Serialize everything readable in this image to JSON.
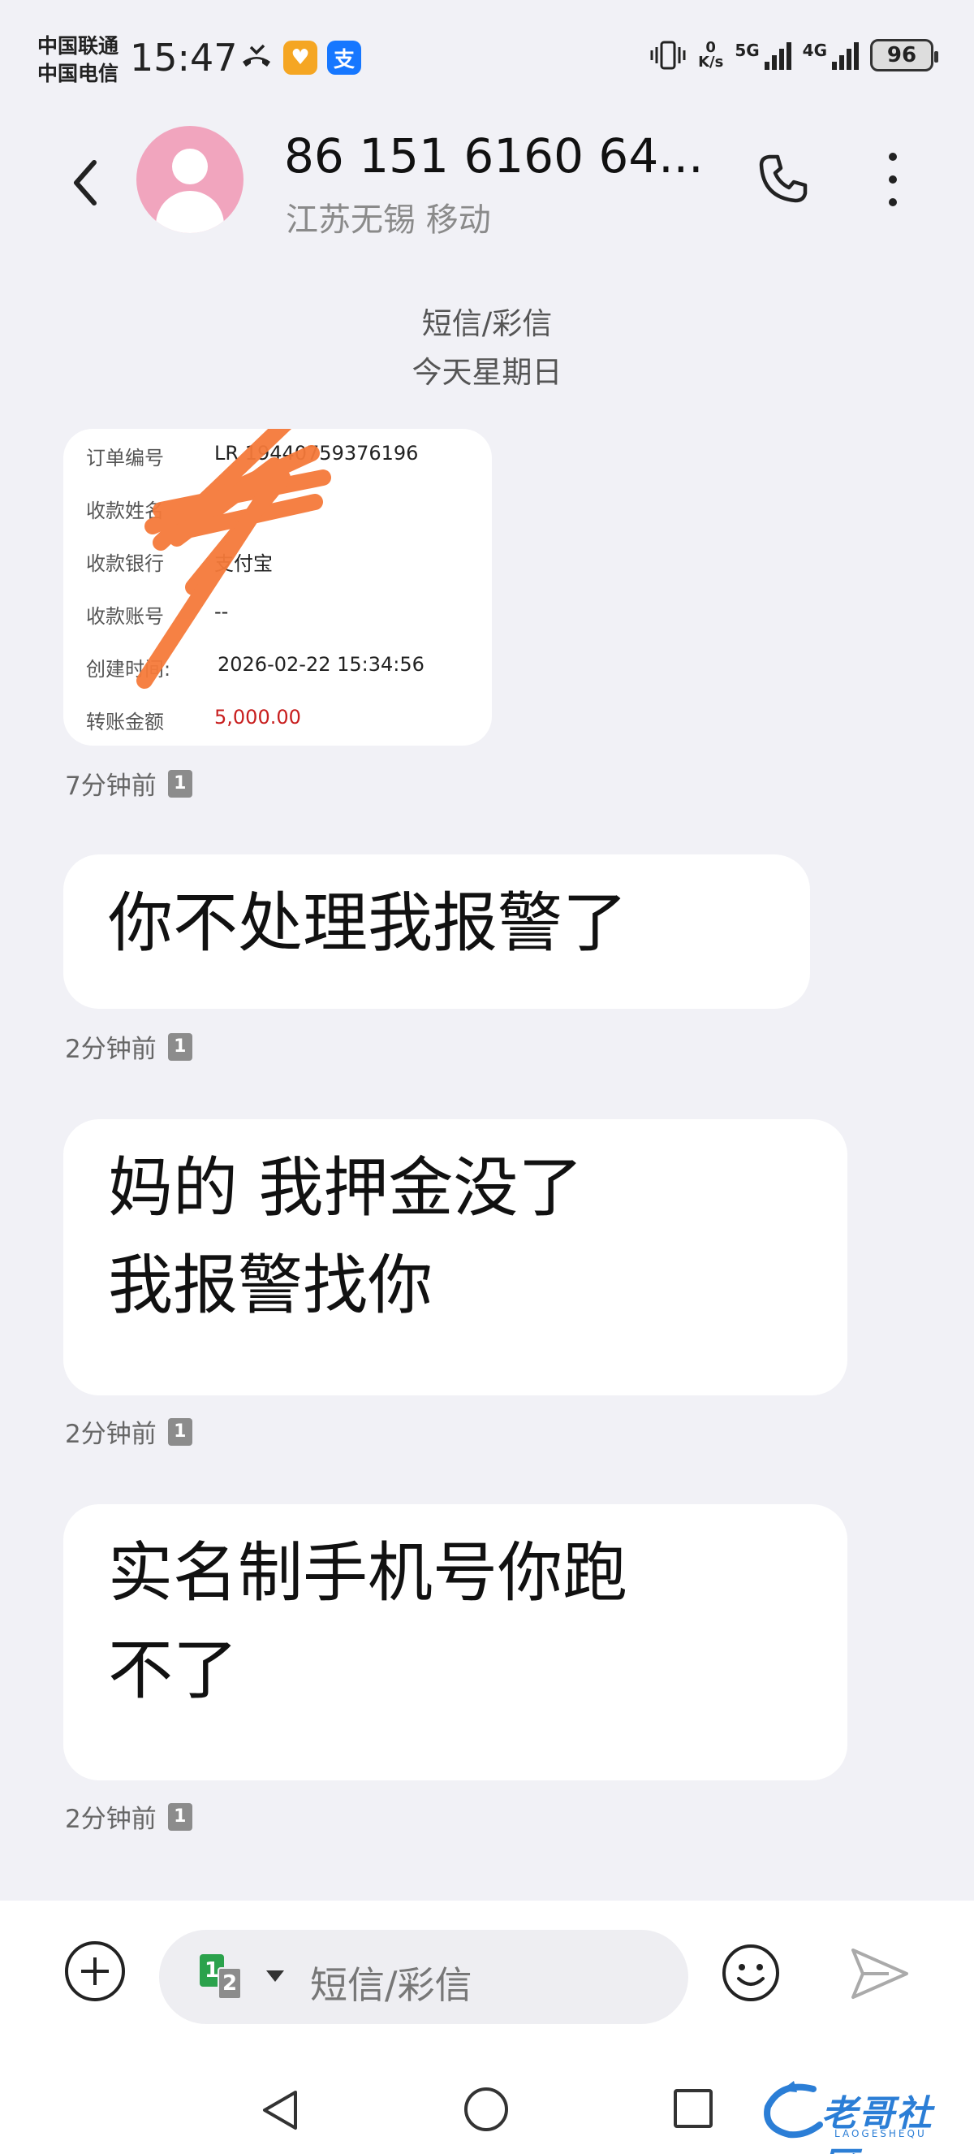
{
  "status_bar": {
    "carrier_1": "中国联通",
    "carrier_2": "中国电信",
    "time": "15:47",
    "net_speed_value": "0",
    "net_speed_unit": "K/s",
    "signal_1": "5G",
    "signal_2": "4G",
    "battery": "96"
  },
  "header": {
    "contact_name": "86 151 6160 64...",
    "contact_location": "江苏无锡 移动"
  },
  "conversation": {
    "type_label": "短信/彩信",
    "date_label": "今天星期日"
  },
  "image_message": {
    "rows": [
      {
        "label": "订单编号",
        "value": "LR     19440759376196"
      },
      {
        "label": "收款姓名",
        "value": ""
      },
      {
        "label": "收款银行",
        "value": "支付宝"
      },
      {
        "label": "收款账号",
        "value": "--"
      },
      {
        "label": "创建时间:",
        "value": "2026-02-22 15:34:56"
      },
      {
        "label": "转账金额",
        "value": "5,000.00"
      }
    ],
    "time": "7分钟前",
    "sim": "1"
  },
  "messages": [
    {
      "text": "你不处理我报警了",
      "time": "2分钟前",
      "sim": "1"
    },
    {
      "text": "妈的 我押金没了\n我报警找你",
      "line1": "妈的 我押金没了",
      "line2": "我报警找你",
      "time": "2分钟前",
      "sim": "1"
    },
    {
      "text": "实名制手机号你跑\n不了",
      "line1": "实名制手机号你跑",
      "line2": "不了",
      "time": "2分钟前",
      "sim": "1"
    }
  ],
  "composer": {
    "placeholder": "短信/彩信",
    "sim_primary": "1",
    "sim_secondary": "2"
  },
  "watermark": {
    "text": "老哥社区",
    "sub": "LAOGESHEQU"
  },
  "colors": {
    "background": "#f1f1f6",
    "bubble": "#ffffff",
    "avatar": "#f1a5be",
    "scribble": "#f57a3a",
    "amount_red": "#c81e1e",
    "sim_green": "#2ba24c"
  }
}
